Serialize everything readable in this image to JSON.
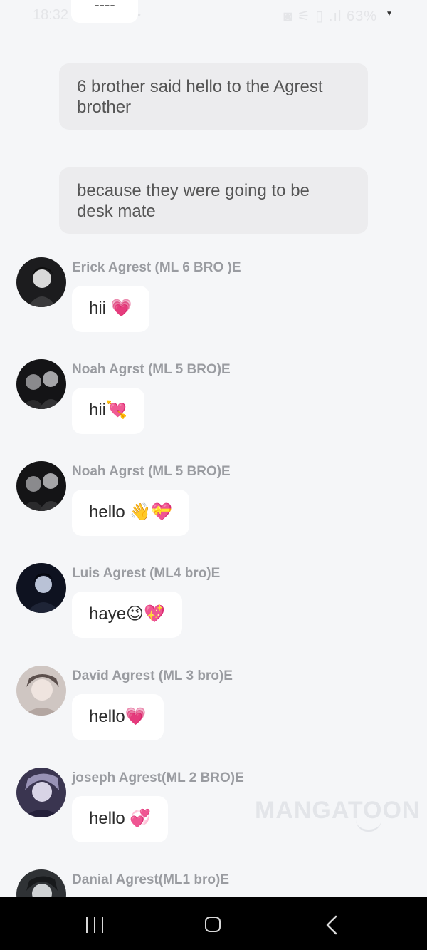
{
  "status_bar": {
    "time": "18:32",
    "right_icons": "◙ ⚟ ▯ .ıl 63%"
  },
  "top_partial_bubble": "----",
  "narrations": [
    {
      "text": "6 brother said hello to the Agrest brother"
    },
    {
      "text": "because they were going to be desk mate"
    }
  ],
  "messages": [
    {
      "name": "Erick Agrest (ML 6 BRO )E",
      "text": "hii 💗"
    },
    {
      "name": "Noah Agrst (ML 5 BRO)E",
      "text": "hii💘"
    },
    {
      "name": "Noah Agrst (ML 5 BRO)E",
      "text": "hello 👋💝"
    },
    {
      "name": "Luis Agrest (ML4 bro)E",
      "text": "haye😉💖"
    },
    {
      "name": "David Agrest (ML 3 bro)E",
      "text": "hello💗"
    },
    {
      "name": "joseph Agrest(ML 2 BRO)E",
      "text": "hello 💞"
    },
    {
      "name": "Danial Agrest(ML1 bro)E",
      "text": ""
    }
  ],
  "watermark": "MANGATOON",
  "nav": {
    "recents_icon": "recents-icon",
    "home_icon": "home-icon",
    "back_icon": "back-icon"
  },
  "colors": {
    "background": "#f5f6f8",
    "bubble": "#ffffff",
    "narration_bubble": "#ececee",
    "name_text": "#9a9ca1",
    "nav_bar": "#000000"
  }
}
